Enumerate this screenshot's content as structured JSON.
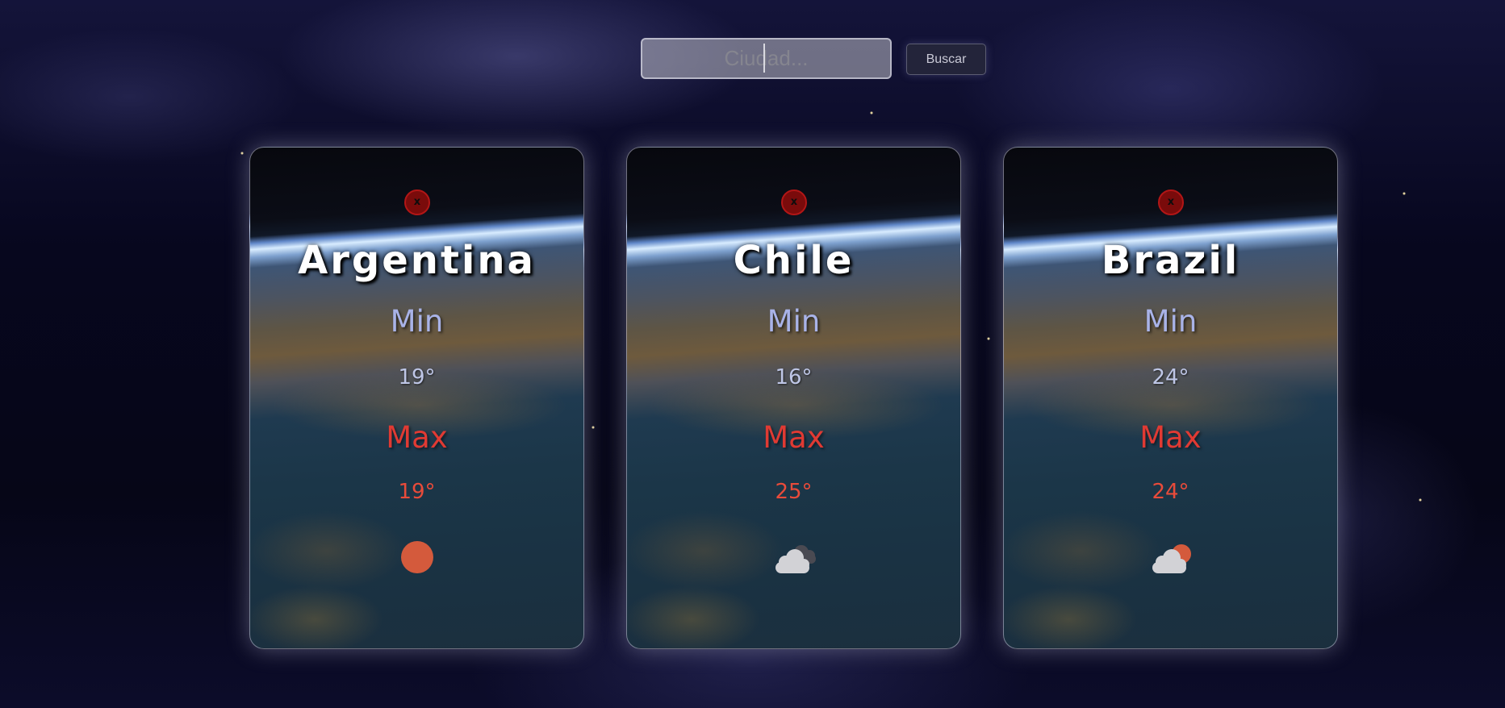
{
  "search": {
    "placeholder": "Ciudad...",
    "button_label": "Buscar"
  },
  "cards": [
    {
      "name": "Argentina",
      "close": "x",
      "min_label": "Min",
      "min_value": "19°",
      "max_label": "Max",
      "max_value": "19°",
      "icon": "sun-icon"
    },
    {
      "name": "Chile",
      "close": "x",
      "min_label": "Min",
      "min_value": "16°",
      "max_label": "Max",
      "max_value": "25°",
      "icon": "clouds-icon"
    },
    {
      "name": "Brazil",
      "close": "x",
      "min_label": "Min",
      "min_value": "24°",
      "max_label": "Max",
      "max_value": "24°",
      "icon": "partly-cloudy-icon"
    }
  ],
  "colors": {
    "close_red": "#7a0b0b",
    "max_red": "#e03a33",
    "min_blue": "#a9b3e8",
    "sun_orange": "#d45a3c"
  }
}
